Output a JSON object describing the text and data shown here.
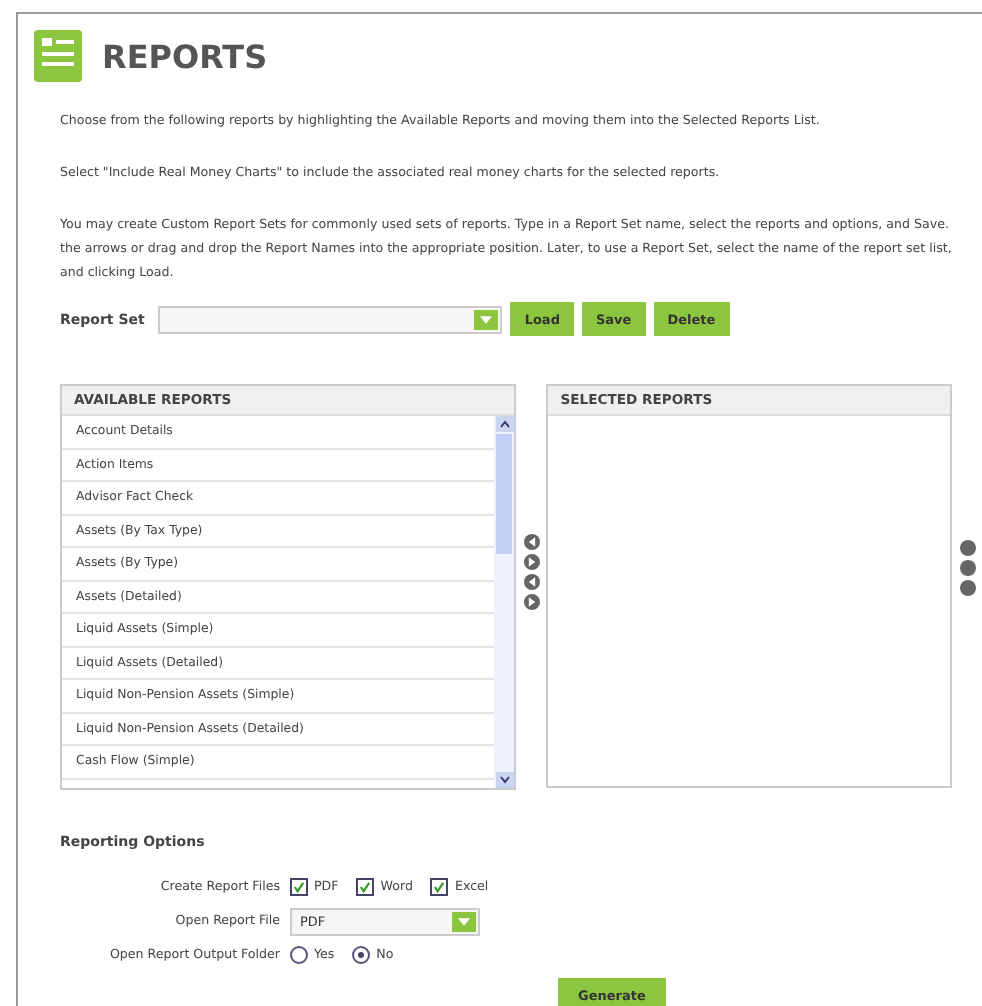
{
  "title": "REPORTS",
  "intro": [
    "Choose from the following reports by highlighting the Available Reports and moving them into the Selected Reports List.",
    "Select \"Include Real Money Charts\" to include the associated real money charts for the selected reports.",
    "You may create Custom Report Sets for commonly used sets of reports. Type in a Report Set name, select the reports and options, and Save. the arrows or drag and drop the Report Names into the appropriate position. Later, to use a Report Set, select the name of the report set list, and clicking Load."
  ],
  "report_set": {
    "label": "Report Set",
    "buttons": [
      "Load",
      "Save",
      "Delete"
    ]
  },
  "available": {
    "title": "AVAILABLE REPORTS",
    "items": [
      {
        "label": "Account Details",
        "selected": false
      },
      {
        "label": "Action Items",
        "selected": false
      },
      {
        "label": "Advisor Fact Check",
        "selected": false
      },
      {
        "label": "Assets (By Tax Type)",
        "selected": false
      },
      {
        "label": "Assets (By Type)",
        "selected": false
      },
      {
        "label": "Assets (Detailed)",
        "selected": false
      },
      {
        "label": "Liquid Assets (Simple)",
        "selected": false
      },
      {
        "label": "Liquid Assets (Detailed)",
        "selected": false
      },
      {
        "label": "Liquid Non-Pension Assets (Simple)",
        "selected": false
      },
      {
        "label": "Liquid Non-Pension Assets (Detailed)",
        "selected": false
      },
      {
        "label": "Cash Flow (Simple)",
        "selected": false
      }
    ]
  },
  "selected": {
    "title": "SELECTED REPORTS"
  },
  "options": {
    "title": "Reporting Options",
    "files_label": "Create Report Files",
    "files": [
      {
        "label": "PDF",
        "checked": true
      },
      {
        "label": "Word",
        "checked": true
      },
      {
        "label": "Excel",
        "checked": true
      }
    ],
    "open_file_label": "Open Report File",
    "open_file_value": "PDF",
    "folder_label": "Open Report Output Folder",
    "folder": [
      {
        "label": "Yes",
        "selected": false
      },
      {
        "label": "No",
        "selected": true
      }
    ]
  },
  "generate": "Generate"
}
